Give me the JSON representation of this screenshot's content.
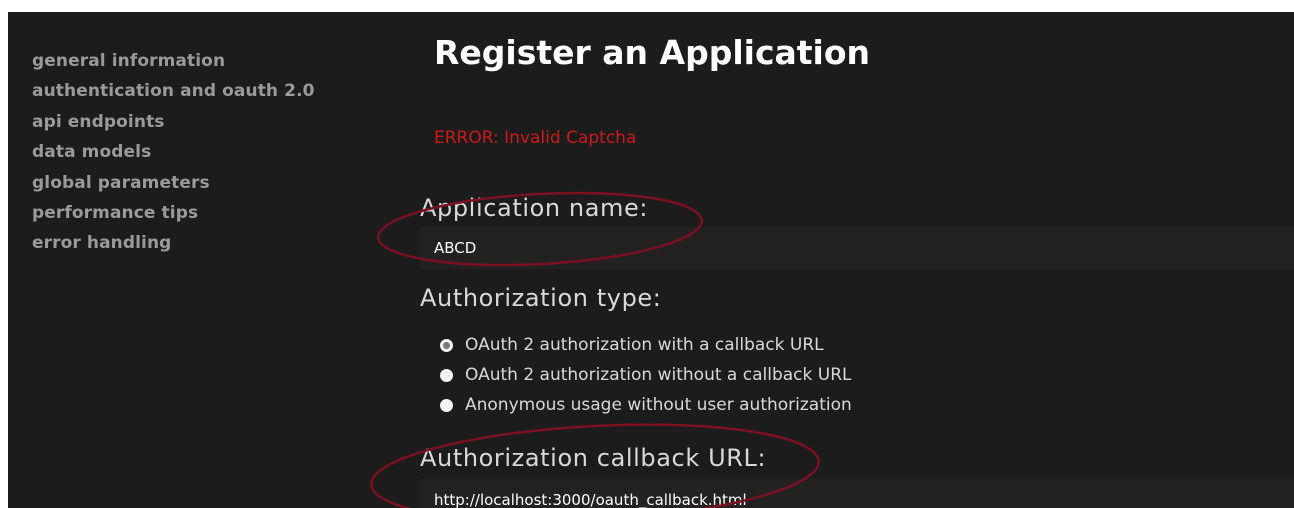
{
  "sidebar": {
    "items": [
      {
        "label": "general information"
      },
      {
        "label": "authentication and oauth 2.0"
      },
      {
        "label": "api endpoints"
      },
      {
        "label": "data models"
      },
      {
        "label": "global parameters"
      },
      {
        "label": "performance tips"
      },
      {
        "label": "error handling"
      }
    ]
  },
  "main": {
    "title": "Register an Application",
    "error": "ERROR: Invalid Captcha",
    "app_name_label": "Application name:",
    "app_name_value": "ABCD",
    "auth_type_label": "Authorization type:",
    "auth_options": [
      {
        "label": "OAuth 2 authorization with a callback URL",
        "checked": true
      },
      {
        "label": "OAuth 2 authorization without a callback URL",
        "checked": false
      },
      {
        "label": "Anonymous usage without user authorization",
        "checked": false
      }
    ],
    "callback_label": "Authorization callback URL:",
    "callback_value": "http://localhost:3000/oauth_callback.html"
  },
  "colors": {
    "background": "#1c1c1c",
    "error": "#cc1a1a",
    "annotation": "#7a1020",
    "sidebar_text": "#9a9a9a"
  }
}
